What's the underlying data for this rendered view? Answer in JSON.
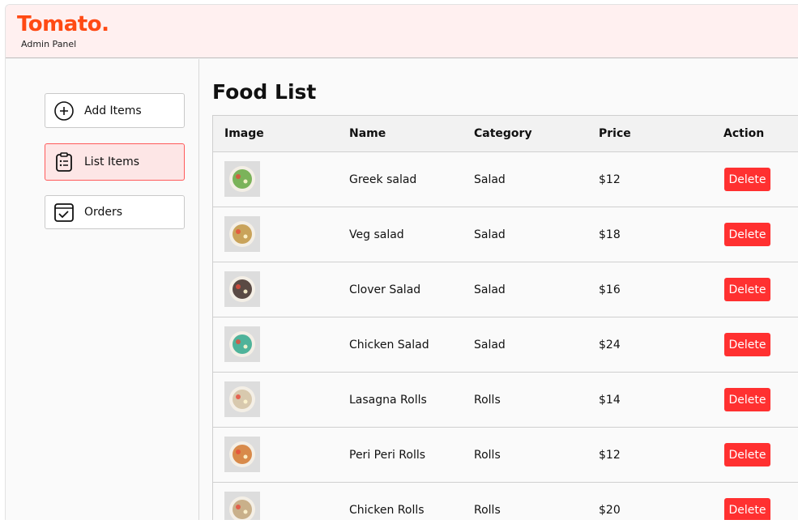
{
  "header": {
    "logo": "Tomato.",
    "subtitle": "Admin Panel"
  },
  "sidebar": {
    "items": [
      {
        "label": "Add Items",
        "icon": "plus-circle-icon",
        "active": false
      },
      {
        "label": "List Items",
        "icon": "clipboard-list-icon",
        "active": true
      },
      {
        "label": "Orders",
        "icon": "checkbox-icon",
        "active": false
      }
    ]
  },
  "main": {
    "title": "Food List",
    "columns": [
      "Image",
      "Name",
      "Category",
      "Price",
      "Action"
    ],
    "delete_label": "Delete",
    "rows": [
      {
        "name": "Greek salad",
        "category": "Salad",
        "price": "$12",
        "thumb_color": "#7bb35a"
      },
      {
        "name": "Veg salad",
        "category": "Salad",
        "price": "$18",
        "thumb_color": "#c9a35a"
      },
      {
        "name": "Clover Salad",
        "category": "Salad",
        "price": "$16",
        "thumb_color": "#5a4a44"
      },
      {
        "name": "Chicken Salad",
        "category": "Salad",
        "price": "$24",
        "thumb_color": "#4fb39a"
      },
      {
        "name": "Lasagna Rolls",
        "category": "Rolls",
        "price": "$14",
        "thumb_color": "#d8c9ae"
      },
      {
        "name": "Peri Peri Rolls",
        "category": "Rolls",
        "price": "$12",
        "thumb_color": "#d88a4a"
      },
      {
        "name": "Chicken Rolls",
        "category": "Rolls",
        "price": "$20",
        "thumb_color": "#c9b08a"
      }
    ]
  },
  "colors": {
    "brand": "#ff4a14",
    "delete": "#ff3030",
    "active_bg": "#fde6e6",
    "header_bg": "#fff0f0"
  }
}
